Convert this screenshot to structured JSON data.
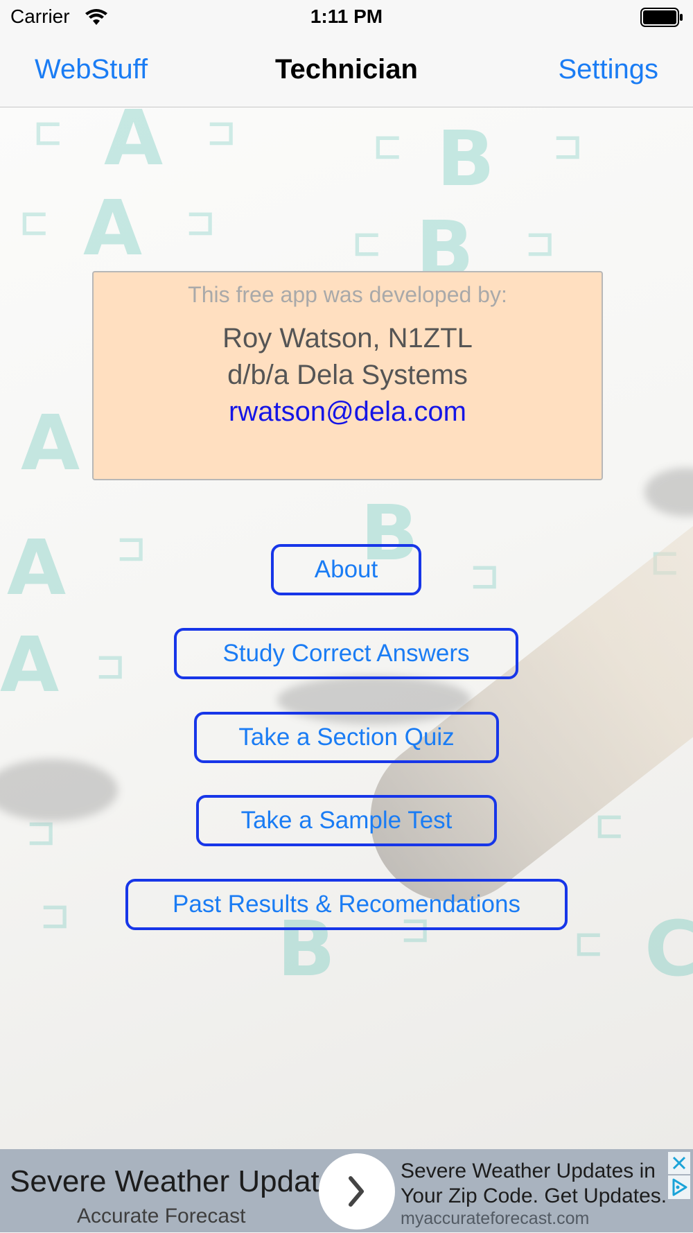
{
  "status_bar": {
    "carrier": "Carrier",
    "time": "1:11 PM",
    "icons": [
      "wifi-icon",
      "battery-icon"
    ]
  },
  "nav": {
    "left_label": "WebStuff",
    "title": "Technician",
    "right_label": "Settings"
  },
  "credit": {
    "intro": "This free app was developed by:",
    "name": "Roy Watson, N1ZTL",
    "company": "d/b/a Dela Systems",
    "email": "rwatson@dela.com"
  },
  "buttons": {
    "about": "About",
    "study": "Study Correct Answers",
    "quiz": "Take a Section Quiz",
    "test": "Take a Sample Test",
    "past": "Past Results & Recomendations"
  },
  "ad": {
    "headline": "Severe Weather Update",
    "brand": "Accurate Forecast",
    "body_line1": "Severe Weather Updates in",
    "body_line2": "Your Zip Code. Get Updates.",
    "url": "myaccurateforecast.com",
    "icons": [
      "chevron-right-icon",
      "ad-close-icon",
      "ad-choices-icon"
    ]
  },
  "colors": {
    "link_blue": "#1a7cf4",
    "button_border": "#1736e8",
    "credit_bg": "#ffdfc0",
    "email_blue": "#1515e6",
    "ad_bg": "#a9b3bf",
    "answer_sheet_teal": "#5cc3b5"
  }
}
